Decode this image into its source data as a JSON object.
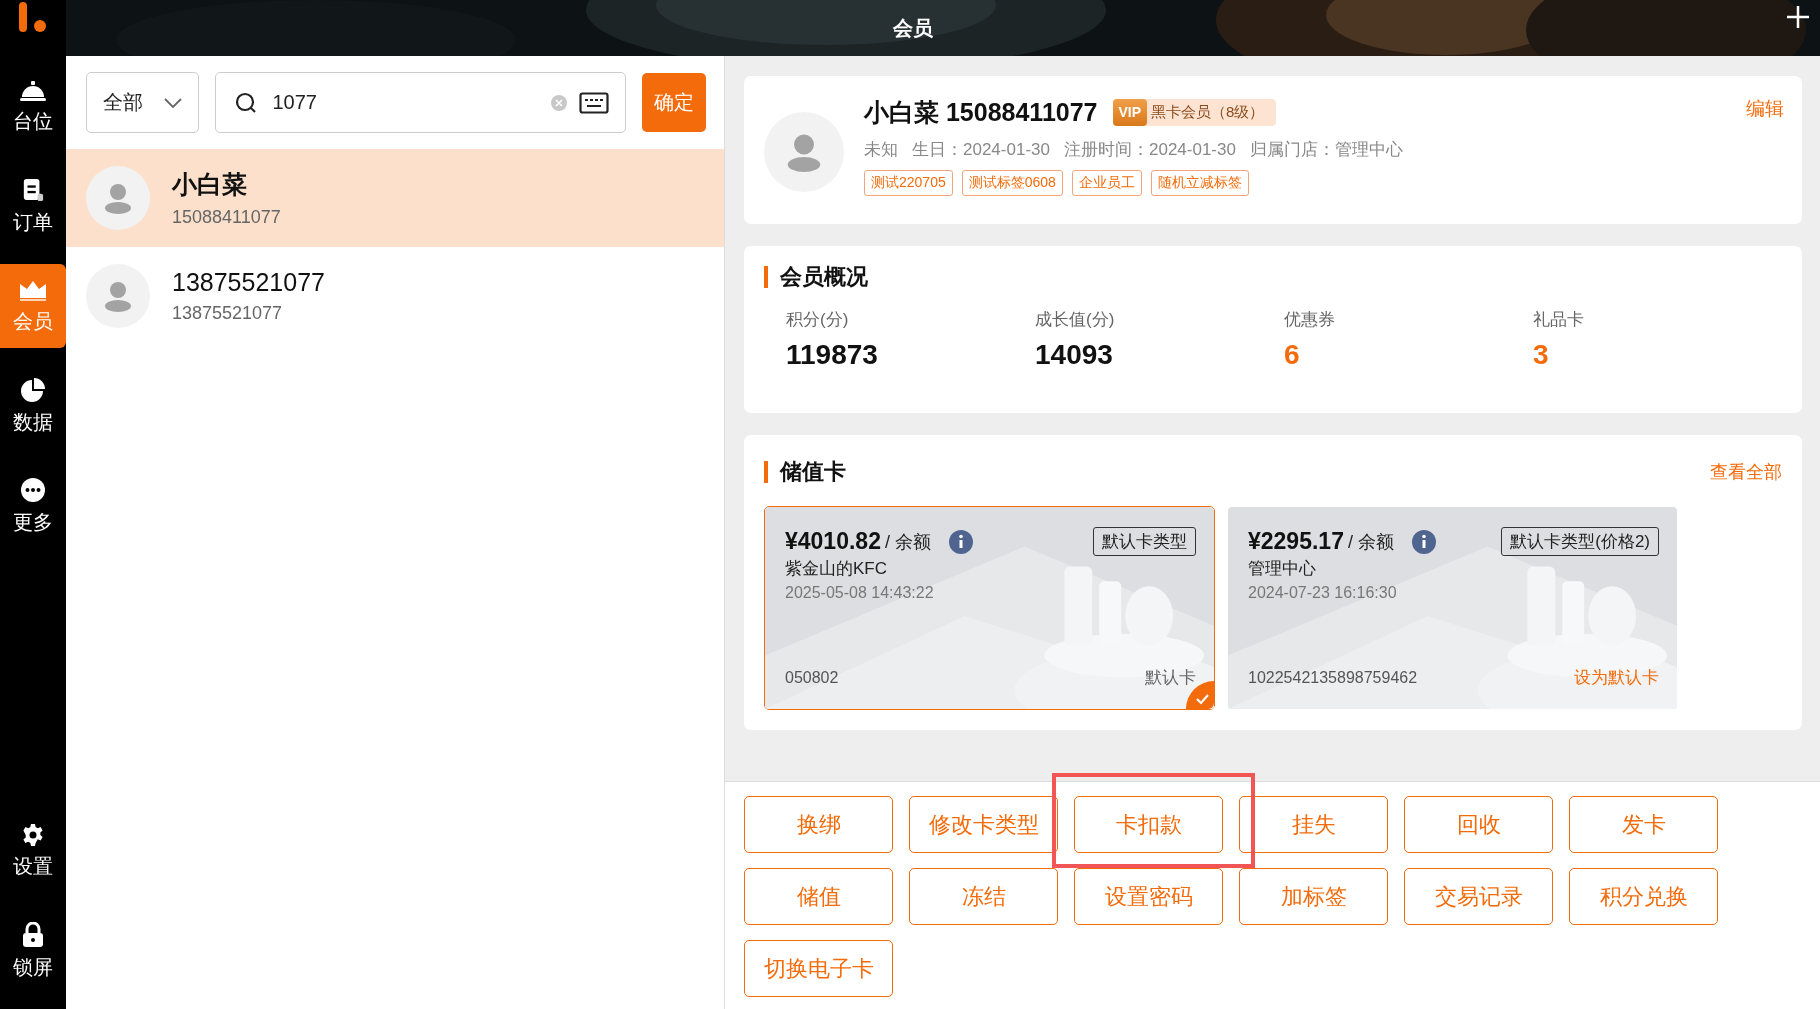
{
  "sidebar": {
    "items": [
      {
        "label": "台位",
        "selected": false
      },
      {
        "label": "订单",
        "selected": false
      },
      {
        "label": "会员",
        "selected": true
      },
      {
        "label": "数据",
        "selected": false
      },
      {
        "label": "更多",
        "selected": false
      }
    ],
    "bottom_items": [
      {
        "label": "设置",
        "selected": false
      },
      {
        "label": "锁屏",
        "selected": false
      }
    ]
  },
  "header": {
    "title": "会员"
  },
  "search": {
    "filter": "全部",
    "value": "1077",
    "confirm": "确定"
  },
  "members": [
    {
      "name": "小白菜",
      "phone": "15088411077",
      "selected": true
    },
    {
      "name": "13875521077",
      "phone": "13875521077",
      "selected": false
    }
  ],
  "profile": {
    "name": "小白菜 15088411077",
    "vip_badge": "VIP",
    "level": "黑卡会员（8级）",
    "edit": "编辑",
    "details": [
      "未知",
      "生日：2024-01-30",
      "注册时间：2024-01-30",
      "归属门店：管理中心"
    ],
    "tags": [
      "测试220705",
      "测试标签0608",
      "企业员工",
      "随机立减标签"
    ]
  },
  "overview": {
    "title": "会员概况",
    "stats": [
      {
        "label": "积分(分)",
        "value": "119873",
        "accent": false
      },
      {
        "label": "成长值(分)",
        "value": "14093",
        "accent": false
      },
      {
        "label": "优惠券",
        "value": "6",
        "accent": true
      },
      {
        "label": "礼品卡",
        "value": "3",
        "accent": true
      }
    ]
  },
  "stored_cards": {
    "title": "储值卡",
    "view_all": "查看全部",
    "cards": [
      {
        "amount": "¥4010.82",
        "unit": "/ 余额",
        "type": "默认卡类型",
        "store": "紫金山的KFC",
        "time": "2025-05-08 14:43:22",
        "number": "050802",
        "action": "默认卡",
        "selected": true
      },
      {
        "amount": "¥2295.17",
        "unit": "/ 余额",
        "type": "默认卡类型(价格2)",
        "store": "管理中心",
        "time": "2024-07-23 16:16:30",
        "number": "1022542135898759462",
        "action": "设为默认卡",
        "selected": false
      }
    ]
  },
  "actions": [
    {
      "label": "换绑",
      "highlighted": false
    },
    {
      "label": "修改卡类型",
      "highlighted": false
    },
    {
      "label": "卡扣款",
      "highlighted": true
    },
    {
      "label": "挂失",
      "highlighted": false
    },
    {
      "label": "回收",
      "highlighted": false
    },
    {
      "label": "发卡",
      "highlighted": false
    },
    {
      "label": "储值",
      "highlighted": false
    },
    {
      "label": "冻结",
      "highlighted": false
    },
    {
      "label": "设置密码",
      "highlighted": false
    },
    {
      "label": "加标签",
      "highlighted": false
    },
    {
      "label": "交易记录",
      "highlighted": false
    },
    {
      "label": "积分兑换",
      "highlighted": false
    },
    {
      "label": "切换电子卡",
      "highlighted": false
    }
  ]
}
